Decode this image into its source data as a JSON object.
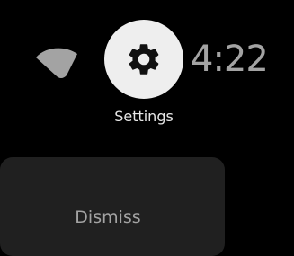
{
  "status": {
    "wifi_icon": "wifi-icon",
    "time": "4:22"
  },
  "quick_action": {
    "icon": "gear-icon",
    "label": "Settings"
  },
  "notification": {
    "dismiss_label": "Dismiss"
  },
  "colors": {
    "background": "#000000",
    "settings_circle": "#eeeeee",
    "gear": "#111111",
    "wifi": "#a3a3a3",
    "clock_text": "#a3a3a3",
    "card": "#202020",
    "dismiss_text": "#a3a3a3"
  }
}
